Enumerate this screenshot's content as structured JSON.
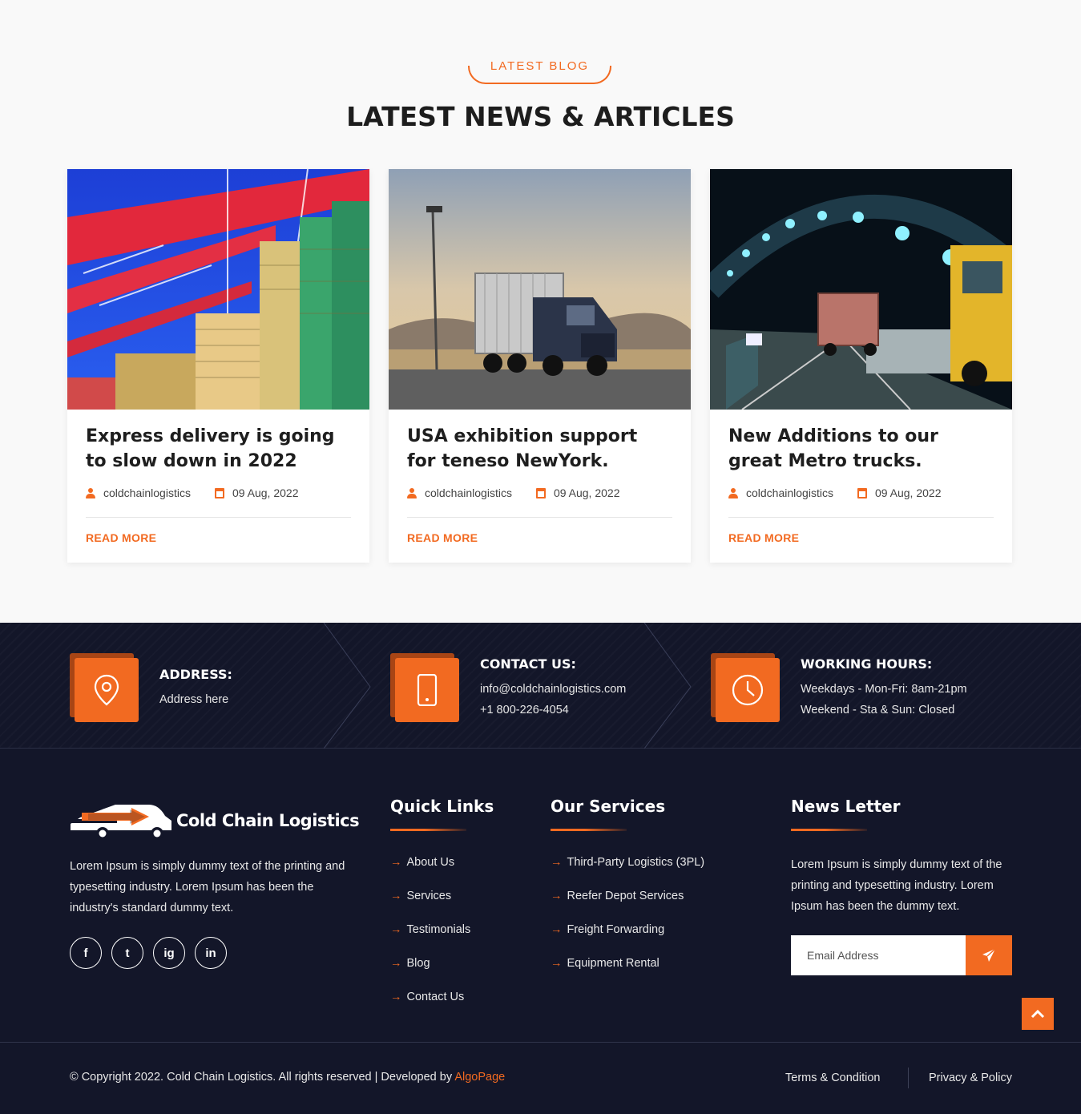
{
  "blog": {
    "eyebrow": "LATEST BLOG",
    "title": "LATEST NEWS & ARTICLES",
    "posts": [
      {
        "title": "Express delivery is going to slow down in 2022",
        "author": "coldchainlogistics",
        "date": "09 Aug, 2022",
        "cta": "READ MORE"
      },
      {
        "title": "USA exhibition support for teneso NewYork.",
        "author": "coldchainlogistics",
        "date": "09 Aug, 2022",
        "cta": "READ MORE"
      },
      {
        "title": "New Additions to our great Metro trucks.",
        "author": "coldchainlogistics",
        "date": "09 Aug, 2022",
        "cta": "READ MORE"
      }
    ]
  },
  "contact_strip": {
    "address": {
      "title": "ADDRESS:",
      "lines": [
        "Address here"
      ],
      "icon": "map-pin-icon"
    },
    "contact": {
      "title": "CONTACT US:",
      "lines": [
        "info@coldchainlogistics.com",
        "+1 800-226-4054"
      ],
      "icon": "phone-icon"
    },
    "hours": {
      "title": "WORKING HOURS:",
      "lines": [
        "Weekdays - Mon-Fri: 8am-21pm",
        "Weekend - Sta & Sun: Closed"
      ],
      "icon": "clock-icon"
    }
  },
  "footer": {
    "brand": "Cold Chain Logistics",
    "about": "Lorem Ipsum is simply dummy text of the printing and typesetting industry. Lorem Ipsum has been the industry's standard dummy text.",
    "socials": [
      {
        "icon": "facebook-icon",
        "glyph": "f"
      },
      {
        "icon": "twitter-icon",
        "glyph": "t"
      },
      {
        "icon": "instagram-icon",
        "glyph": "ig"
      },
      {
        "icon": "linkedin-icon",
        "glyph": "in"
      }
    ],
    "quick_links": {
      "title": "Quick Links",
      "items": [
        "About Us",
        "Services",
        "Testimonials",
        "Blog",
        "Contact Us"
      ]
    },
    "services": {
      "title": "Our Services",
      "items": [
        "Third-Party Logistics (3PL)",
        "Reefer Depot Services",
        "Freight Forwarding",
        "Equipment Rental"
      ]
    },
    "newsletter": {
      "title": "News Letter",
      "text": "Lorem Ipsum is simply dummy text of the printing and typesetting industry. Lorem Ipsum has been the dummy text.",
      "placeholder": "Email Address"
    },
    "copyright": "© Copyright 2022. Cold Chain Logistics. All rights reserved | Developed by",
    "developer": "AlgoPage",
    "terms": "Terms & Condition",
    "privacy": "Privacy & Policy"
  },
  "colors": {
    "accent": "#f26a21",
    "dark": "#131629"
  }
}
